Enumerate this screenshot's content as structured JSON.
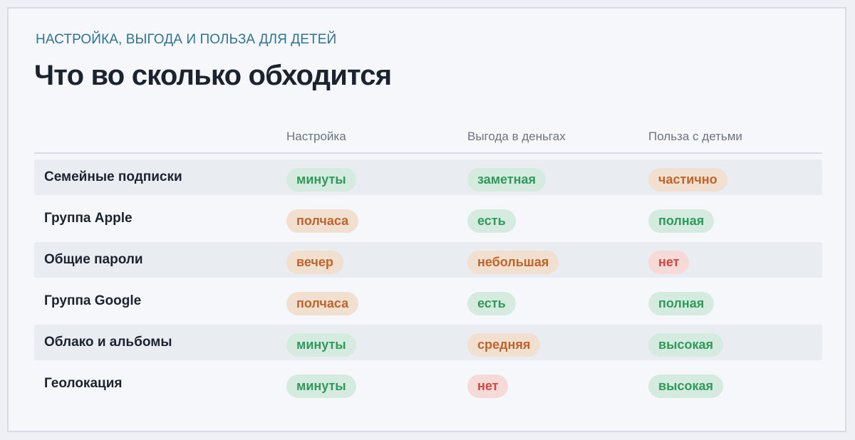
{
  "header": {
    "eyebrow": "НАСТРОЙКА, ВЫГОДА И ПОЛЬЗА ДЛЯ ДЕТЕЙ",
    "title": "Что во сколько обходится"
  },
  "table": {
    "columns": [
      "Настройка",
      "Выгода в деньгах",
      "Польза с детьми"
    ],
    "rows": [
      {
        "label": "Семейные подписки",
        "shaded": true,
        "cells": [
          {
            "text": "минуты",
            "tone": "green"
          },
          {
            "text": "заметная",
            "tone": "green"
          },
          {
            "text": "частично",
            "tone": "orange"
          }
        ]
      },
      {
        "label": "Группа Apple",
        "shaded": false,
        "cells": [
          {
            "text": "полчаса",
            "tone": "orange"
          },
          {
            "text": "есть",
            "tone": "green"
          },
          {
            "text": "полная",
            "tone": "green"
          }
        ]
      },
      {
        "label": "Общие пароли",
        "shaded": true,
        "cells": [
          {
            "text": "вечер",
            "tone": "orange"
          },
          {
            "text": "небольшая",
            "tone": "orange"
          },
          {
            "text": "нет",
            "tone": "red"
          }
        ]
      },
      {
        "label": "Группа Google",
        "shaded": false,
        "cells": [
          {
            "text": "полчаса",
            "tone": "orange"
          },
          {
            "text": "есть",
            "tone": "green"
          },
          {
            "text": "полная",
            "tone": "green"
          }
        ]
      },
      {
        "label": "Облако и альбомы",
        "shaded": true,
        "cells": [
          {
            "text": "минуты",
            "tone": "green"
          },
          {
            "text": "средняя",
            "tone": "orange"
          },
          {
            "text": "высокая",
            "tone": "green"
          }
        ]
      },
      {
        "label": "Геолокация",
        "shaded": false,
        "cells": [
          {
            "text": "минуты",
            "tone": "green"
          },
          {
            "text": "нет",
            "tone": "red"
          },
          {
            "text": "высокая",
            "tone": "green"
          }
        ]
      }
    ]
  },
  "colors": {
    "green_text": "#2f9a5b",
    "orange_text": "#c0642b",
    "red_text": "#d5443e",
    "accent": "#2e7396"
  }
}
